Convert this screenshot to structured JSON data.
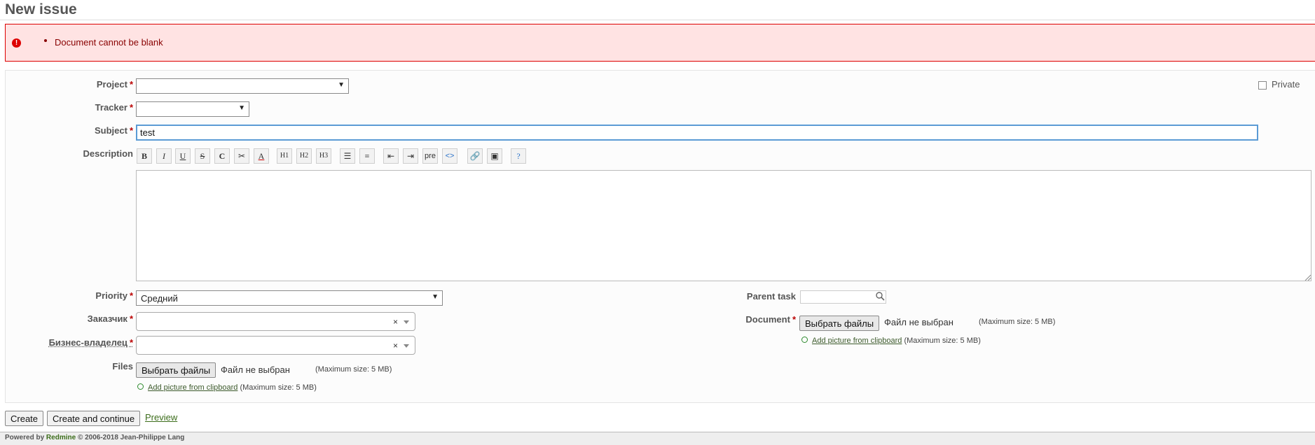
{
  "page": {
    "title": "New issue"
  },
  "error": {
    "messages": [
      "Document cannot be blank"
    ]
  },
  "form": {
    "project": {
      "label": "Project",
      "required": "*",
      "value": ""
    },
    "private": {
      "label": "Private"
    },
    "tracker": {
      "label": "Tracker",
      "required": "*",
      "value": ""
    },
    "subject": {
      "label": "Subject",
      "required": "*",
      "value": "test"
    },
    "description": {
      "label": "Description",
      "toolbar": [
        "B",
        "I",
        "U",
        "S",
        "C",
        "cut",
        "A",
        "H1",
        "H2",
        "H3",
        "ul",
        "ol",
        "indent-left",
        "indent-right",
        "pre",
        "<>",
        "link",
        "image",
        "help"
      ]
    },
    "priority": {
      "label": "Priority",
      "required": "*",
      "value": "Средний"
    },
    "customer": {
      "label": "Заказчик",
      "required": "*",
      "value": "",
      "clear": "×"
    },
    "business_owner": {
      "label": "Бизнес-владелец",
      "required": "*",
      "value": "",
      "clear": "×"
    },
    "files": {
      "label": "Files",
      "button": "Выбрать файлы",
      "no_file": "Файл не выбран",
      "max_size": "(Maximum size: 5 MB)",
      "add_picture": "Add picture from clipboard",
      "add_picture_max": "(Maximum size: 5 MB)"
    },
    "parent_task": {
      "label": "Parent task",
      "value": ""
    },
    "document": {
      "label": "Document",
      "required": "*",
      "button": "Выбрать файлы",
      "no_file": "Файл не выбран",
      "max_size": "(Maximum size: 5 MB)",
      "add_picture": "Add picture from clipboard",
      "add_picture_max": "(Maximum size: 5 MB)"
    }
  },
  "actions": {
    "create": "Create",
    "create_continue": "Create and continue",
    "preview": "Preview"
  },
  "footer": {
    "powered_by": "Powered by",
    "link": "Redmine",
    "copyright": "© 2006-2018 Jean-Philippe Lang"
  },
  "colors": {
    "error_bg": "#ffe3e3",
    "error_border": "#dd0000",
    "link": "#3c6d1b",
    "required": "#bb0000"
  }
}
